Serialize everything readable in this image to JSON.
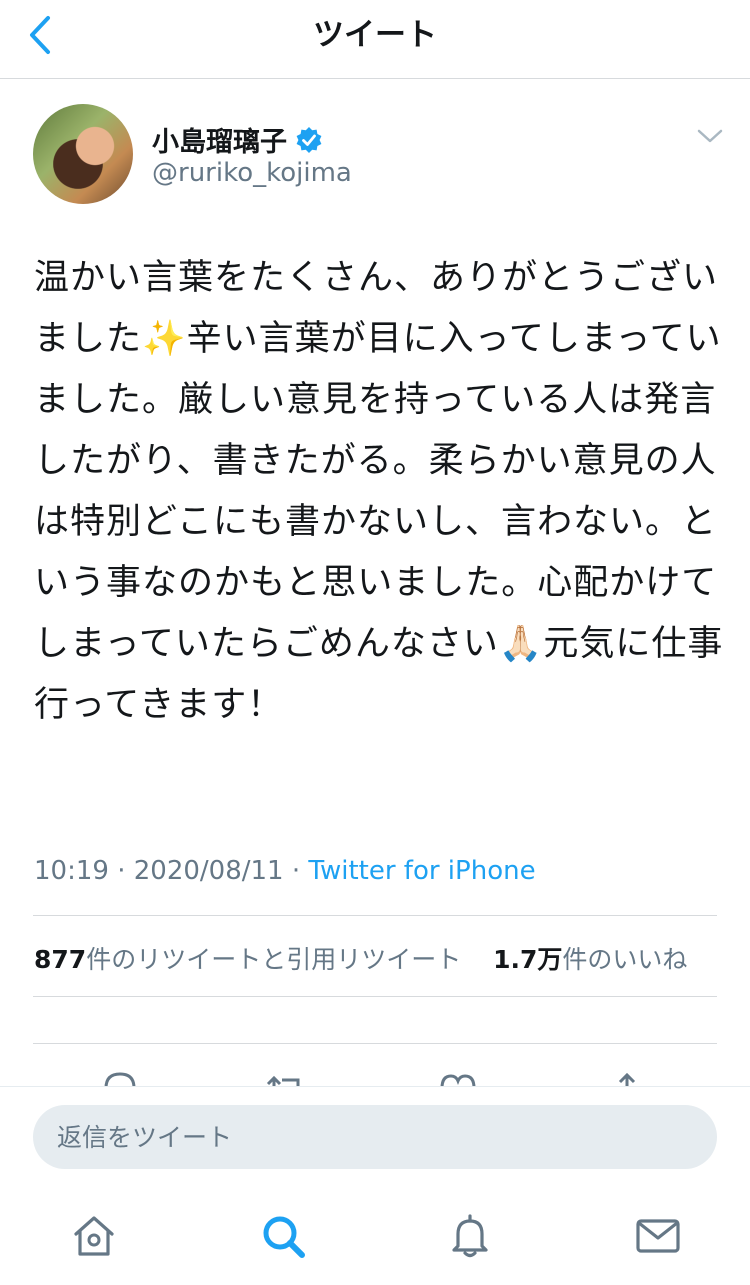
{
  "header": {
    "title": "ツイート",
    "back_icon": "chevron-left-icon"
  },
  "tweet": {
    "display_name": "小島瑠璃子",
    "handle": "@ruriko_kojima",
    "text": "温かい言葉をたくさん、ありがとうございました✨辛い言葉が目に入ってしまっていました。厳しい意見を持っている人は発言したがり、書きたがる。柔らかい意見の人は特別どこにも書かないし、言わない。という事なのかもと思いました。心配かけてしまっていたらごめんなさい🙏🏻元気に仕事行ってきます！",
    "time": "10:19",
    "date": "2020/08/11",
    "separator": "·",
    "source": "Twitter for iPhone",
    "retweet_count": "877",
    "retweet_label": "件のリツイートと引用リツイート",
    "like_count": "1.7万",
    "like_label": "件のいいね"
  },
  "reply": {
    "placeholder": "返信をツイート"
  },
  "tabs": [
    "home-icon",
    "search-icon",
    "notifications-icon",
    "messages-icon"
  ],
  "colors": {
    "accent": "#1da1f2",
    "verified": "#1da1f2",
    "secondary_text": "#657786",
    "divider": "#d7dadd"
  }
}
